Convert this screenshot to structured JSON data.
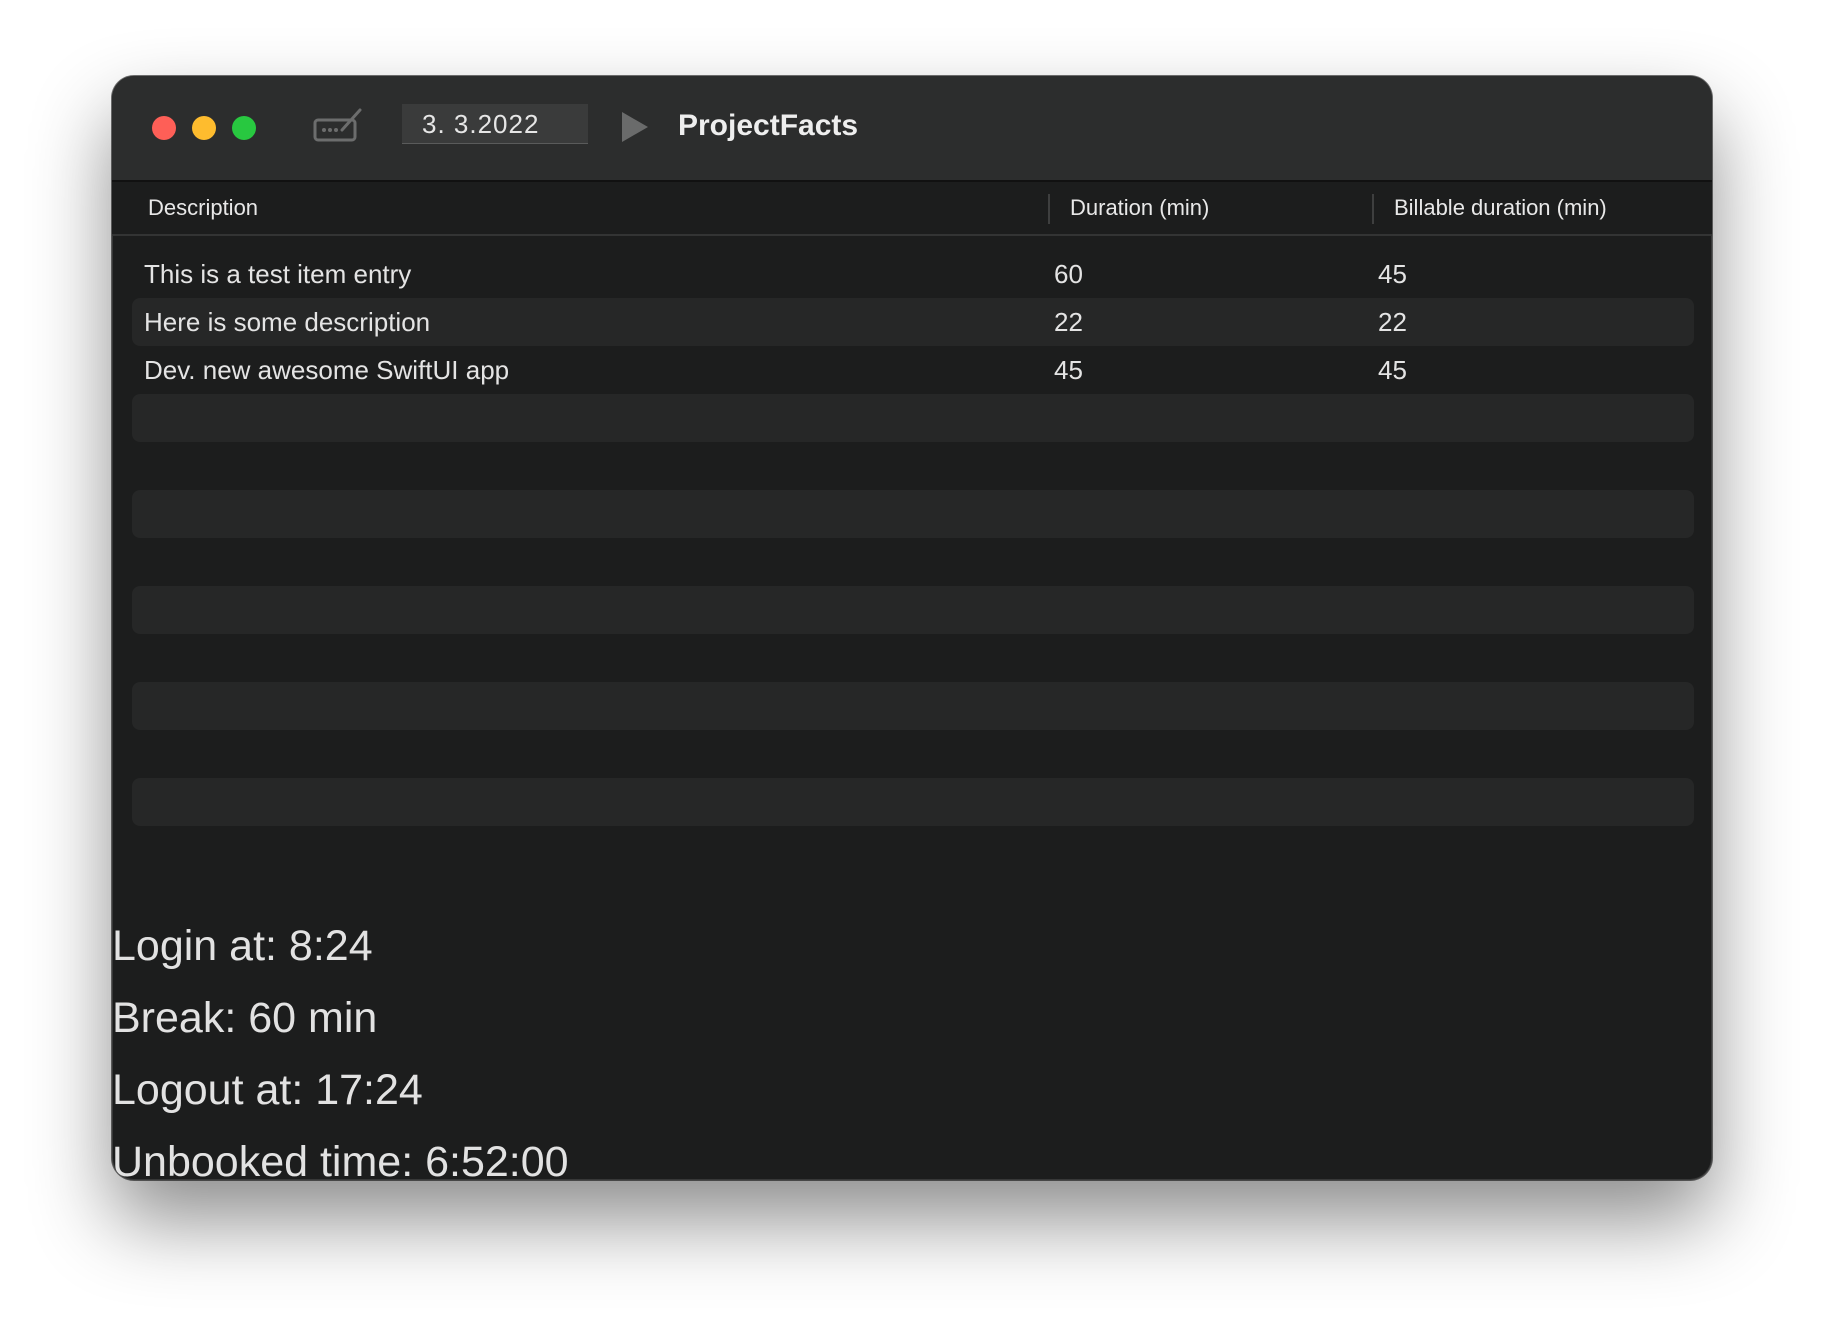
{
  "window": {
    "title": "ProjectFacts",
    "date": "3.  3.2022"
  },
  "toolbar": {
    "edit_icon": "signature-icon",
    "play_icon": "play-icon"
  },
  "table": {
    "columns": [
      "Description",
      "Duration (min)",
      "Billable duration (min)"
    ],
    "rows": [
      {
        "description": "This is a test item entry",
        "duration": "60",
        "billable": "45"
      },
      {
        "description": "Here is some description",
        "duration": "22",
        "billable": "22"
      },
      {
        "description": "Dev. new awesome SwiftUI app",
        "duration": "45",
        "billable": "45"
      }
    ]
  },
  "summary": {
    "login": "Login at: 8:24",
    "break": "Break: 60 min",
    "logout": "Logout at: 17:24",
    "unbooked": "Unbooked time: 6:52:00"
  },
  "colors": {
    "close": "#fe5f57",
    "minimize": "#febc2e",
    "maximize": "#28c840",
    "background": "#1c1d1d",
    "titlebar": "#2c2d2d",
    "alt_row": "#262727"
  }
}
